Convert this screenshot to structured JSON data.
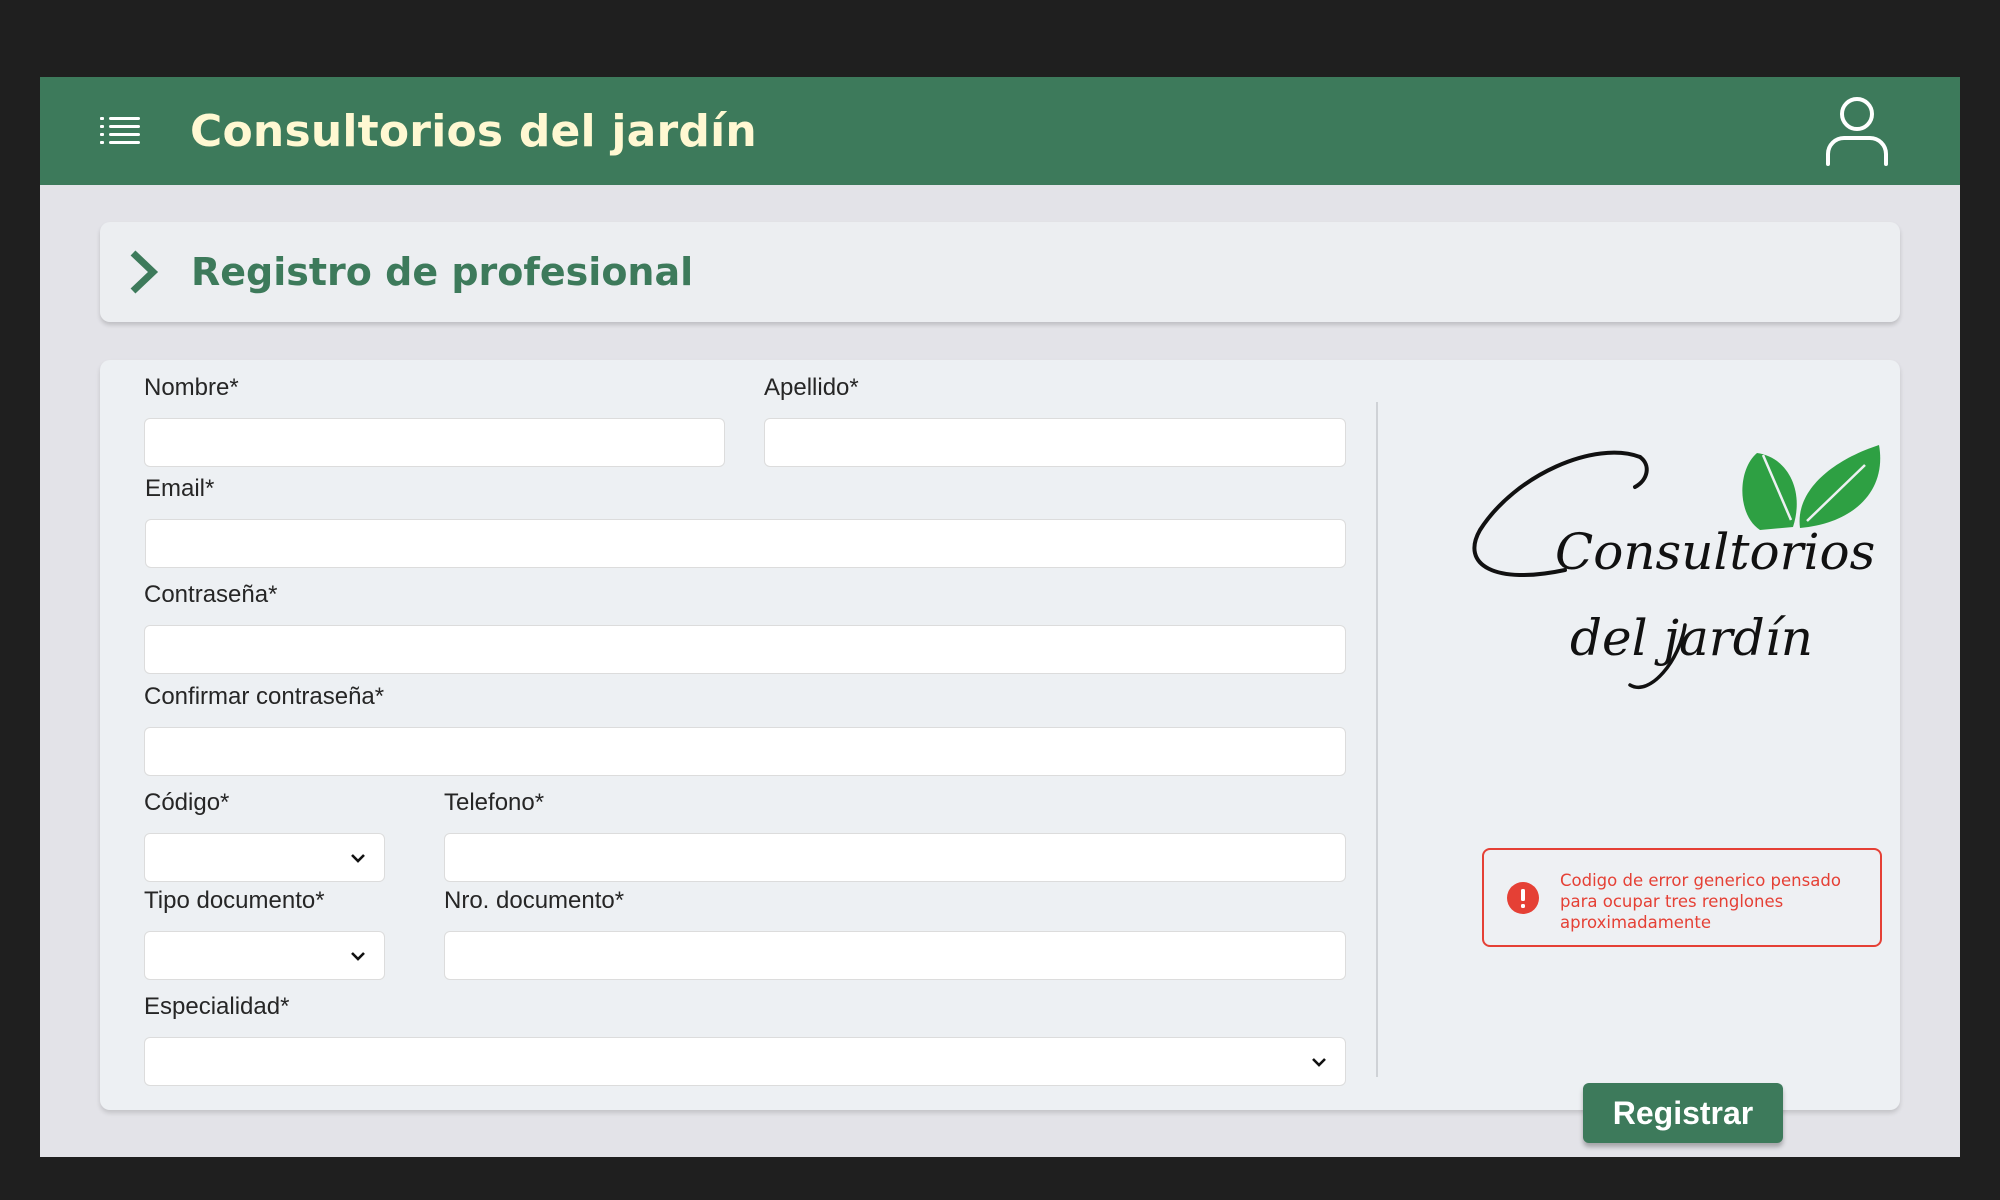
{
  "header": {
    "title": "Consultorios del jardín",
    "menu_icon": "list-icon",
    "user_icon": "user-icon",
    "color": "#3d7a5b",
    "title_color": "#fff8d2"
  },
  "section": {
    "title": "Registro de profesional",
    "icon": "chevron-right-icon"
  },
  "form": {
    "nombre": {
      "label": "Nombre*",
      "value": ""
    },
    "apellido": {
      "label": "Apellido*",
      "value": ""
    },
    "email": {
      "label": "Email*",
      "value": ""
    },
    "contrasena": {
      "label": "Contraseña*",
      "value": ""
    },
    "confirmar": {
      "label": "Confirmar contraseña*",
      "value": ""
    },
    "codigo": {
      "label": "Código*",
      "value": ""
    },
    "telefono": {
      "label": "Telefono*",
      "value": ""
    },
    "tipo_documento": {
      "label": "Tipo documento*",
      "value": ""
    },
    "nro_documento": {
      "label": "Nro. documento*",
      "value": ""
    },
    "especialidad": {
      "label": "Especialidad*",
      "value": ""
    }
  },
  "logo": {
    "line1": "Consultorios",
    "line2": "del jardín",
    "leaf_color": "#2ea043"
  },
  "error": {
    "message": "Codigo de error generico pensado para ocupar tres renglones aproximadamente",
    "color": "#e54035"
  },
  "submit": {
    "label": "Registrar"
  }
}
